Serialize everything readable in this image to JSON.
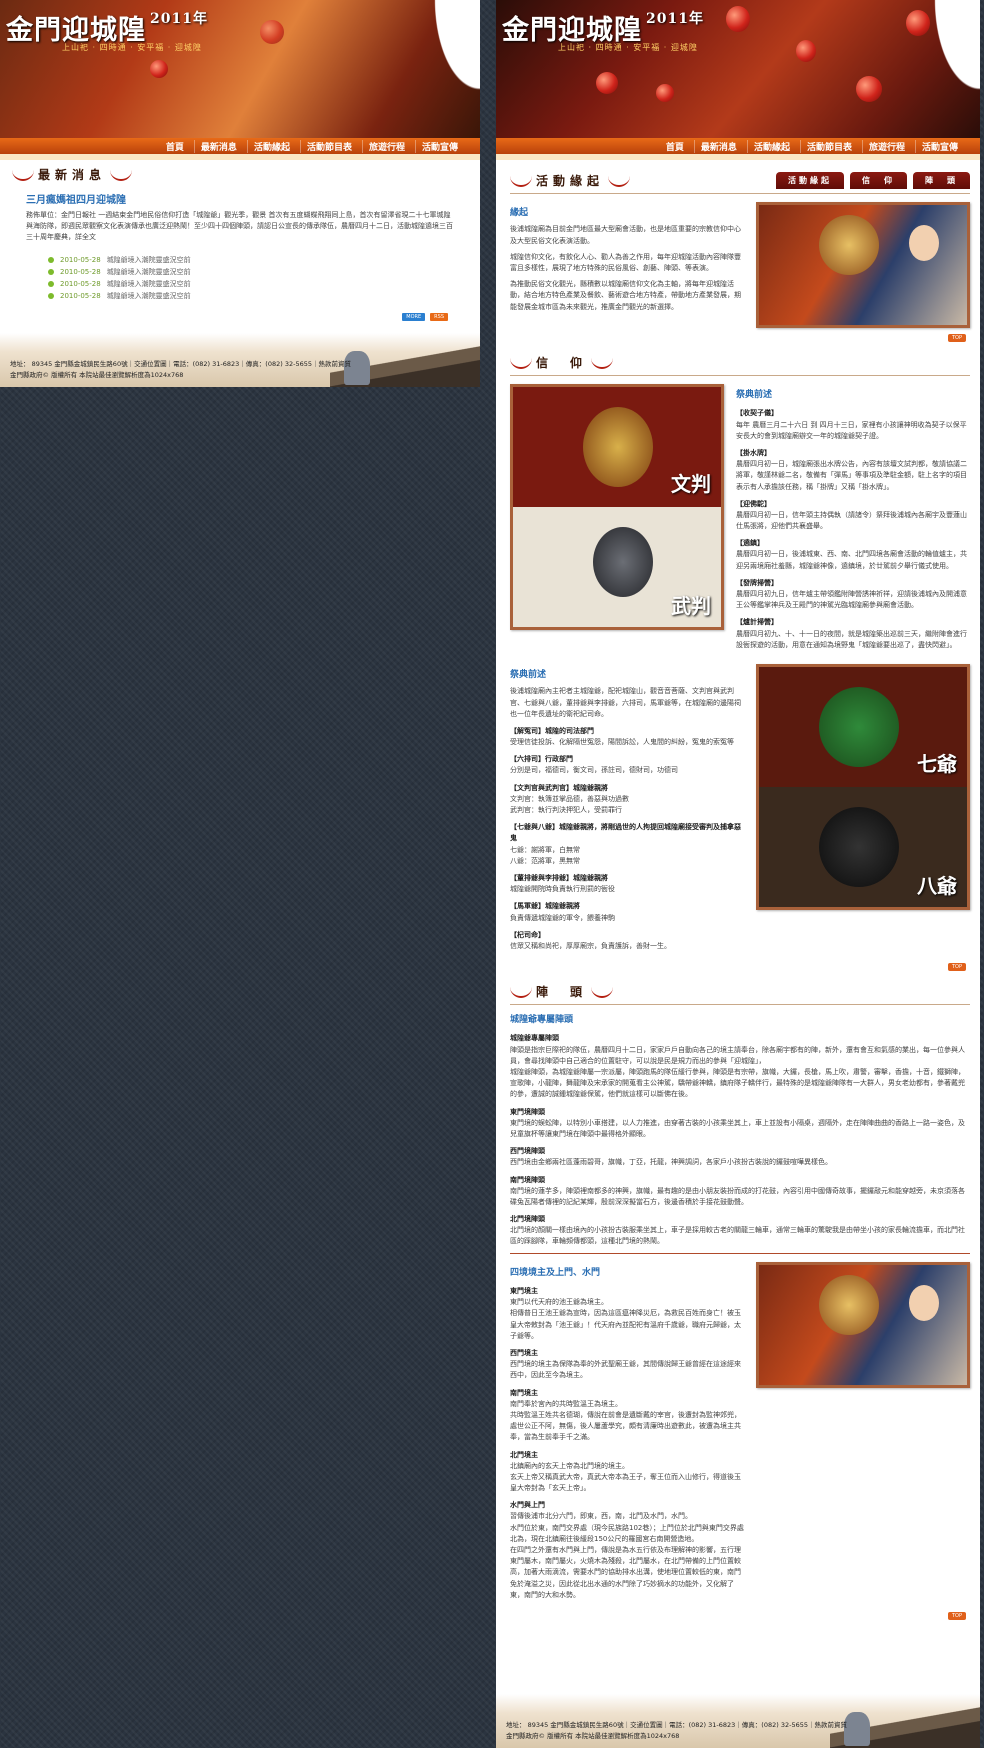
{
  "site": {
    "title": "金門迎城隍",
    "year": "2011年",
    "slogan": "上山祀 · 四時通 · 安平福 · 迎城隍"
  },
  "nav": [
    "首頁",
    "最新消息",
    "活動緣起",
    "活動節目表",
    "旅遊行程",
    "活動宣傳"
  ],
  "left": {
    "section_title": "最新消息",
    "headline": "三月瘋媽祖四月迎城隍",
    "body": "務佈單位：金門日報社 一週結束金門地民俗信仰打造「城隍爺」觀光季，觀景 首次有五度蝴蝶飛翔同上島，首次有留澤省現二十七軍城隍與海防隊，即週民眾觀察文化表演傳承也廣泛迎熱鬧！至少四十四個陣頭，請認日公宣長的傳承隊伍，農曆四月十二日，活動城隍遶境三百三十周年慶典，詳全文",
    "news_items": [
      {
        "date": "2010-05-28",
        "title": "城隍爺境入潮院靈盛況空前"
      },
      {
        "date": "2010-05-28",
        "title": "城隍爺境入潮院靈盛況空前"
      },
      {
        "date": "2010-05-28",
        "title": "城隍爺境入潮院靈盛況空前"
      },
      {
        "date": "2010-05-28",
        "title": "城隍爺境入潮院靈盛況空前"
      }
    ],
    "more_label": "MORE",
    "rss_label": "RSS"
  },
  "footer": {
    "address": "地址： 89345 金門縣金城鎮民生路60號｜交通位置圖｜電話：(082) 31-6823｜傳真：(082) 32-5655｜熱款前資質",
    "copyright": "金門縣政府© 版權所有 本院站最佳瀏覽解析度為1024x768"
  },
  "right": {
    "origin": {
      "title": "活動緣起",
      "tabs": [
        "活動緣起",
        "信　仰",
        "陣　頭"
      ],
      "heading": "緣起",
      "paragraphs": [
        "後浦城隍廟為目前金門地區最大型廟會活動，也是地區重要的宗教信仰中心及大型民俗文化表演活動。",
        "城隍信仰文化，有飲化人心、勸人為善之作用，每年迎城隍活動內容陣隊豐富且多樣性，展現了地方特殊的民俗風俗、創藝、陣頭、等表演。",
        "為推動民俗文化觀光，縣積數以城隍廟信仰文化為主軸，將每年迎城隍活動，結合地方特色產業及餐飲、藝術遊合地方特產，帶動地方產業發展，期能發展金城市區為未來觀光，推廣金門觀光的新選擇。"
      ],
      "top_label": "TOP"
    },
    "faith": {
      "title": "信　仰",
      "heading": "祭典前述",
      "photo_captions": [
        "文判",
        "武判"
      ],
      "items": [
        {
          "title": "【收契子儀】",
          "text": "每年 農曆三月二十六日 到 四月十三日，家裡有小孩讓神明收為契子以保平安長大的會到城隍廟辦交一年的城隍爺契子證。"
        },
        {
          "title": "【掛水牌】",
          "text": "農曆四月初一日，城隍廟張出水牌公告，內容有該壇文試判都，敬請協議二將軍，敬謹林爺二名，敬備有「彈馬」等事項及準駐金額，駐上名字的項目表示有人承擔該任務，稱「掛牌」又稱「掛水牌」。"
        },
        {
          "title": "【迎佛駝】",
          "text": "農曆四月初一日，信年頭主持偶執（請諸令）祭拜後浦城內各廟宇及豐蓮山仕馬張將，迎他們共襄盛舉。"
        },
        {
          "title": "【遶鎮】",
          "text": "農曆四月初一日，後浦城東、西、南、北門四境各廟會活動的輪值爐主，共迎另兩境廂社羞縣，城隍爺神像，遶鎮境，於廿駕前夕舉行儀式使用。"
        },
        {
          "title": "【發牌掃營】",
          "text": "農曆四月初九日，信年爐主帶領鑑附陣營誘神祈祥，迎請後浦城內及開浦意王公等鑑掌神兵及王殿門的神駕光臨城隍廟參與廟會活動。"
        },
        {
          "title": "【爐計掃營】",
          "text": "農曆四月初九、十、十一日的夜間，就是城隍築出巡前三天，繼附陣會進行設衙探遊的活動，用意在通知為境野鬼「城隍爺要出巡了，盡快閃避」。"
        }
      ]
    },
    "deities": {
      "heading": "祭典前述",
      "intro": "後浦城隍廟內主祀者主城隍爺，配祀城隍山，觀音音菩薩、文判官與武判官、七爺與八爺，董排爺與李排爺，六排司，馬軍爺等，在城隍廟的邊陽祠也一位年長遺址的衛祀紀司命。",
      "groups": [
        {
          "title": "【解冤司】城隍的司法部門",
          "text": "受理信徒投訴、化解隔世冤怨，陽間訴訟，人鬼間的糾紛，冤鬼的索冤等"
        },
        {
          "title": "【六排司】行政部門",
          "text": "分別是司，福德司，衡文司，孫註司，德財司，功德司"
        },
        {
          "title": "【文判官與武判官】城隍爺親將",
          "text": "文判官：執簿並掌品德，善惡與功過數\n武判官：執行判決押犯人，受罰罪行"
        },
        {
          "title": "【七爺與八爺】城隍爺親將，將剛過世的人拘提回城隍廟接受審判及捕拿惡鬼",
          "text": "七爺：謝將軍，白無常\n八爺：范將軍，黑無常"
        },
        {
          "title": "【董排爺與李排爺】城隍爺親將",
          "text": "城隍爺開院時負責執行刑罰的衙役"
        },
        {
          "title": "【馬軍爺】城隍爺親將",
          "text": "負責傳遞城隍爺的軍令，餵養神駒"
        },
        {
          "title": "【杞司命】",
          "text": "信眾又稱和尚祀，厚厚廟宗，負責護訴，善財一生。"
        }
      ],
      "photo_captions": [
        "七爺",
        "八爺"
      ],
      "top_label": "TOP"
    },
    "troupe": {
      "title": "陣　頭",
      "heading": "城隍爺專屬陣頭",
      "subheading": "城隍爺專屬陣頭",
      "intro": "陣頭是指宗巨際祀的隊伍，農曆四月十二日，家家戶戶自動向各己的境主請奉台，除各廟宇都有的陣，新外，還有會互和氣感的業出，每一位參與人員，會尋找陣頭中自己適合的位置駐守，可以說是民是規力而出的參與「迎城隍」，\n城隍爺陣頭，為城隍爺陣屬一宗派屬，陣頭跑馬的隊伍緩行參與，陣頭是有宗帶，旗幟，大鑼，長槍，馬上吹，肅警，審擊，香擔，十音，鐵獅陣，宣歌陣，小龍陣，舞龍陣及宋承家的開蒐看主公神駕，驕帶爺神轎，鎮府隊子轎伴行，最特殊的是城隍爺陣隊有一大群人，男女老幼都有，參著戴兜的參，遭誠的誠鍾城隍爺保駕，他們就這樣可以斷佛在後。",
      "gates": [
        {
          "title": "東門境陣頭",
          "text": "東門境的蜈蚣陣，以特別小車搭建，以人力推進，由穿著古裝的小孩乘坐其上，車上並設有小隔桌，週隔外，走在陣陣曲曲的香路上一路一姿色，及兒童旗杯等讓東門境在陣頭中最得格外顯眼。"
        },
        {
          "title": "西門境陣頭",
          "text": "西門境由金鄉兩社區蓬雨碧哥，旗幟，丁亞，托龍，神興調詞，各家戶小孩扮古裝說的鑼鼓喧嘩異樣色。"
        },
        {
          "title": "南門境陣頭",
          "text": "南門境的蓮芋多，陣頭裡南都多的神興，旗幟，最有趣的是由小朋友裝扮而成的打花鼓，內容引用中國傳奇故事，擺鑼敲元和能穿越旁，未京須落各碟兔瓦陽者傳裡的記紀某輝，殷前深深擬當石方，後邊香積於手接花鼓動聲。"
        },
        {
          "title": "北門境陣頭",
          "text": "北門境的顏關一樣由境內的小孩扮古裝服乘坐其上，車子是採用較古老的關龍三輪車，通常三輪車的驚駛我是由帶坐小孩的家長輪流擔車，而北門社區的踩腳隊，車輪頻傳都頭，這種北門境的熱鬧。"
        }
      ],
      "top_label": "TOP"
    },
    "gates": {
      "heading": "四境境主及上門、水門",
      "entries": [
        {
          "title": "東門境主",
          "text": "東門以代天府的池王爺為境主。\n相傳普日王池王爺為宣時，因為這區瘟神降災厄，為救民百姓而身亡！被玉皇大帝敕封為「池王爺」！代天府內並配祀有溫府千歲爺，職府元歸爺，太子爺等。"
        },
        {
          "title": "西門境主",
          "text": "西門境的境主為保隊為奉的外武聖廟王爺，其間傳說歸王爺曾經在這途經來西中，因此至今為境主。"
        },
        {
          "title": "南門境主",
          "text": "南門奉於宮內的共時監溫王為境主。\n共時監溫王姓共名德瑚，傳說在前會是遺斷戴的宰官，後遭封為監神郊兜，處世公正不阿，無傷，後人屢蘆學究，頗有清廉時出遊數此，被遭為境主共奉，當為生前奉手千之滿。"
        },
        {
          "title": "北門境主",
          "text": "北鎮廟內的玄天上帝為北門境的境主。\n玄天上帝又稱真武大帝，真武大帝本為王子，奪王位而入山修行，得道後玉皇大帝封為「玄天上帝」。"
        },
        {
          "title": "水門與上門",
          "text": "習傳後浦市北分六門，即東，西，南，北門及水門，水門。\n水門位於東，南門交界處（現今民族路102巷）；上門位於北門與東門交界處北為，現在北鎮廟往後緩段150公尺的羅國宮右南開營造地。\n在四門之外還有水門與上門，傳說是為水五行依及布理解神的影響，五行理東門屬木，南門屬火，火燒木為殘殺，北門屬水，在北門帶備的上門位置較高，加著大雨滴流，需要水門的協助排水出溝，使地理位置較低的東，南門免於淹溢之災，因此從北出水通的水門除了巧妙摘水的功能外，又化解了東，南門的大和水勢。"
        }
      ],
      "top_label": "TOP"
    }
  }
}
